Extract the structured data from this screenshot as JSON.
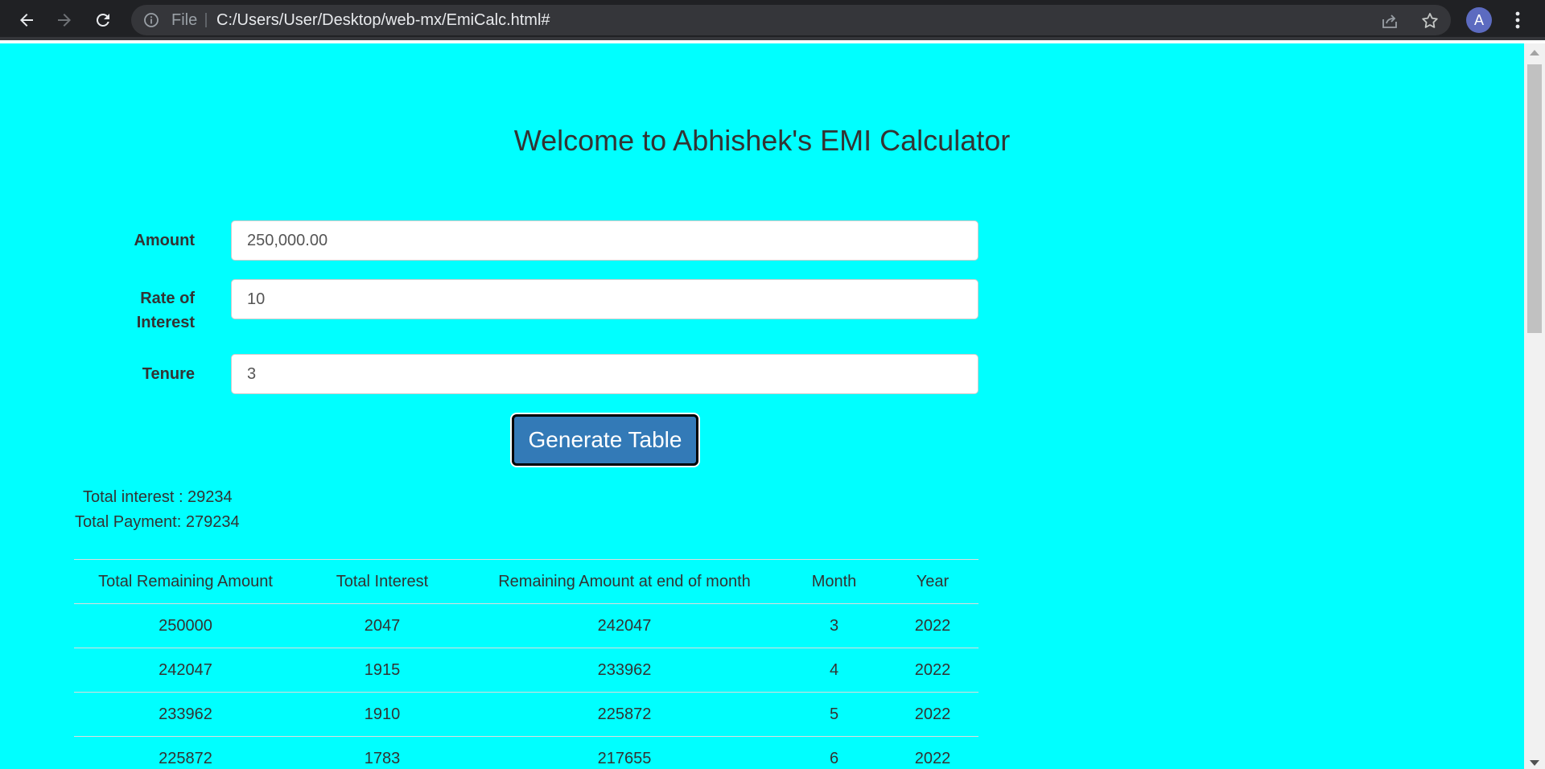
{
  "browser": {
    "scheme": "File",
    "url": "C:/Users/User/Desktop/web-mx/EmiCalc.html#",
    "avatar_letter": "A"
  },
  "page": {
    "background_color": "#00ffff",
    "title": "Welcome to Abhishek's EMI Calculator"
  },
  "form": {
    "amount_label": "Amount",
    "amount_value": "250,000.00",
    "rate_label_line1": "Rate of",
    "rate_label_line2": "Interest",
    "rate_value": "10",
    "tenure_label": "Tenure",
    "tenure_value": "3",
    "button_label": "Generate Table",
    "button_color": "#337ab7"
  },
  "summary": {
    "total_interest": "Total interest : 29234",
    "total_payment": "Total Payment: 279234"
  },
  "table": {
    "headers": [
      "Total Remaining Amount",
      "Total Interest",
      "Remaining Amount at end of month",
      "Month",
      "Year"
    ],
    "rows": [
      [
        "250000",
        "2047",
        "242047",
        "3",
        "2022"
      ],
      [
        "242047",
        "1915",
        "233962",
        "4",
        "2022"
      ],
      [
        "233962",
        "1910",
        "225872",
        "5",
        "2022"
      ],
      [
        "225872",
        "1783",
        "217655",
        "6",
        "2022"
      ]
    ]
  }
}
